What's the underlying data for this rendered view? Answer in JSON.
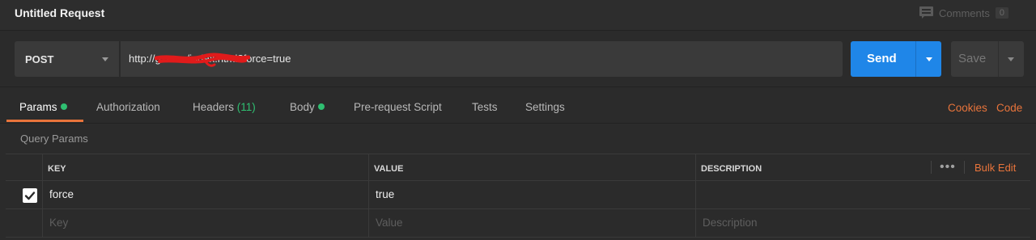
{
  "header": {
    "title": "Untitled Request",
    "comments_label": "Comments",
    "comments_count": "0"
  },
  "request": {
    "method": "POST",
    "url": "http://g                    .com/index.html?force=true",
    "send_label": "Send",
    "save_label": "Save"
  },
  "tabs": [
    {
      "label": "Params",
      "indicator": "dot"
    },
    {
      "label": "Authorization"
    },
    {
      "label": "Headers",
      "count": "(11)"
    },
    {
      "label": "Body",
      "indicator": "dot"
    },
    {
      "label": "Pre-request Script"
    },
    {
      "label": "Tests"
    },
    {
      "label": "Settings"
    }
  ],
  "tab_links": {
    "cookies": "Cookies",
    "code": "Code"
  },
  "params": {
    "section_title": "Query Params",
    "columns": {
      "key": "KEY",
      "value": "VALUE",
      "description": "DESCRIPTION"
    },
    "bulk_edit": "Bulk Edit",
    "more": "•••",
    "rows": [
      {
        "key": "force",
        "value": "true",
        "description": "",
        "checked": true
      }
    ],
    "placeholders": {
      "key": "Key",
      "value": "Value",
      "description": "Description"
    }
  },
  "colors": {
    "accent": "#e8743b",
    "send": "#1f86e8",
    "indicator_green": "#2fbf71",
    "redaction": "#e11b1b"
  }
}
